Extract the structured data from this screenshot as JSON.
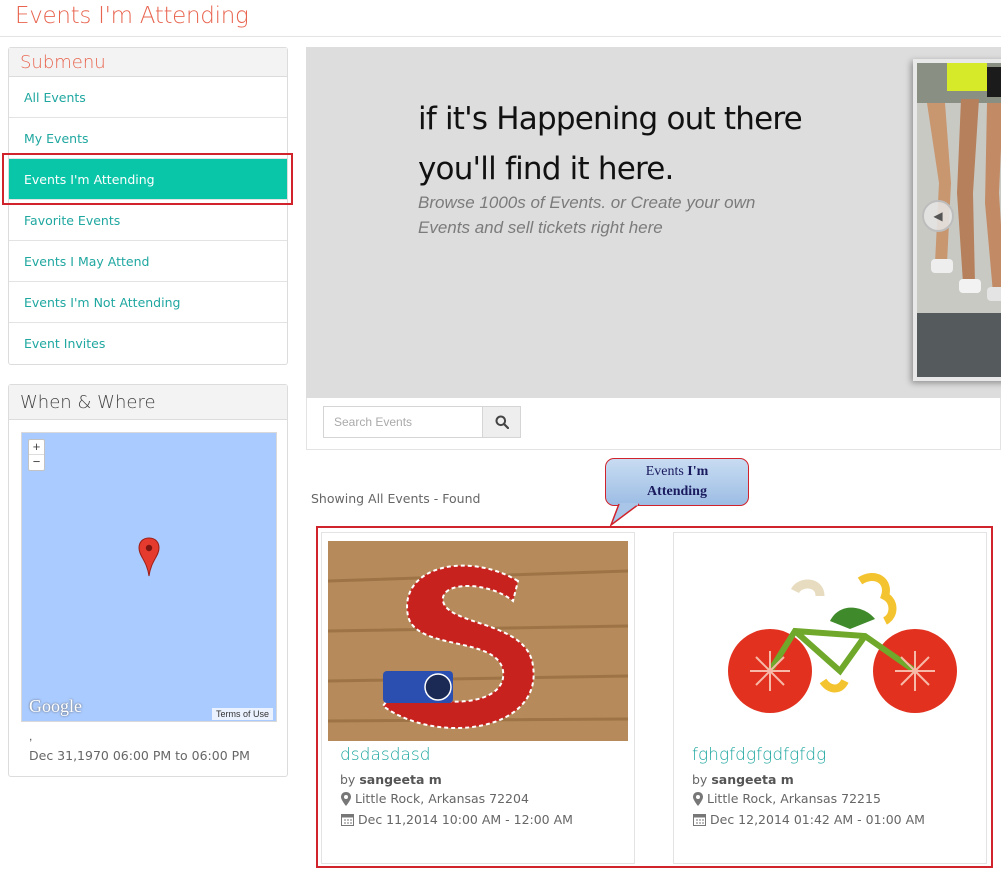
{
  "page": {
    "title": "Events I'm Attending"
  },
  "submenu": {
    "heading": "Submenu",
    "items": [
      {
        "label": "All Events"
      },
      {
        "label": "My Events"
      },
      {
        "label": "Events I'm Attending",
        "active": true
      },
      {
        "label": "Favorite Events"
      },
      {
        "label": "Events I May Attend"
      },
      {
        "label": "Events I'm Not Attending"
      },
      {
        "label": "Event Invites"
      }
    ]
  },
  "when_where": {
    "heading": "When & Where",
    "map": {
      "zoom_in": "+",
      "zoom_out": "−",
      "attribution": "Google",
      "terms": "Terms of Use"
    },
    "location_text": ",",
    "date_text": "Dec 31,1970 06:00 PM to 06:00 PM"
  },
  "hero": {
    "headline_line1": "if it's Happening out there",
    "headline_line2": "you'll find it here.",
    "subline_line1": "Browse 1000s of Events. or Create your own",
    "subline_line2": "Events and sell tickets right here",
    "prev_icon": "chevron-left-icon"
  },
  "search": {
    "placeholder": "Search Events",
    "icon": "search-icon"
  },
  "results": {
    "summary": "Showing All Events - Found"
  },
  "callout": {
    "line1_plain": "Events ",
    "line1_bold": "I'm",
    "line2_bold": "Attending"
  },
  "events": [
    {
      "title": "dsdasdasd",
      "by_prefix": "by ",
      "organizer": "sangeeta m",
      "location": "Little Rock, Arkansas 72204",
      "date": "Dec 11,2014 10:00 AM - 12:00 AM"
    },
    {
      "title": "fghgfdgfgdfgfdg",
      "by_prefix": "by ",
      "organizer": "sangeeta m",
      "location": "Little Rock, Arkansas 72215",
      "date": "Dec 12,2014 01:42 AM - 01:00 AM"
    }
  ],
  "colors": {
    "accent": "#09c6a8",
    "link": "#1fa7a0",
    "title": "#e8644f",
    "highlight_outline": "#d1232b"
  }
}
